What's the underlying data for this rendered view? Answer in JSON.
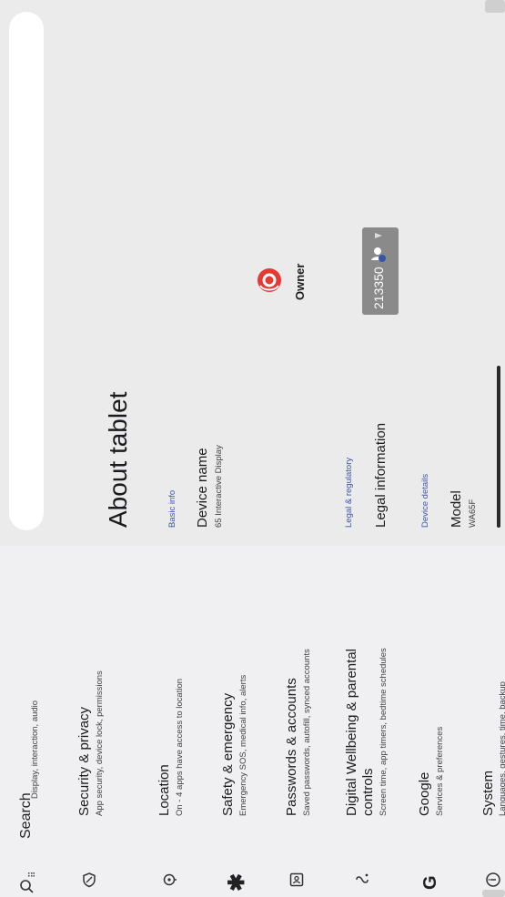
{
  "search": {
    "label": "Search"
  },
  "settings_list": {
    "display_subtitle": "Display, interaction, audio",
    "items": [
      {
        "title": "Security & privacy",
        "subtitle": "App security, device lock, permissions"
      },
      {
        "title": "Location",
        "subtitle": "On - 4 apps have access to location"
      },
      {
        "title": "Safety & emergency",
        "subtitle": "Emergency SOS, medical info, alerts"
      },
      {
        "title": "Passwords & accounts",
        "subtitle": "Saved passwords, autofill, synced accounts"
      },
      {
        "title_line1": "Digital Wellbeing & parental",
        "title_line2": "controls",
        "subtitle": "Screen time, app timers, bedtime schedules"
      },
      {
        "title": "Google",
        "subtitle": "Services & preferences"
      },
      {
        "title": "System",
        "subtitle": "Languages, gestures, time, backup"
      }
    ]
  },
  "about": {
    "page_title": "About tablet",
    "basic_info_header": "Basic info",
    "device_name_label": "Device name",
    "device_name_value": "65 Interactive Display",
    "legal_header": "Legal & regulatory",
    "legal_information": "Legal information",
    "device_details_header": "Device details",
    "model_label": "Model",
    "model_value": "WA65F"
  },
  "status": {
    "text": "213350"
  },
  "owner": {
    "label": "Owner"
  },
  "colors": {
    "accent": "#3655a9",
    "avatar": "#e53935"
  }
}
